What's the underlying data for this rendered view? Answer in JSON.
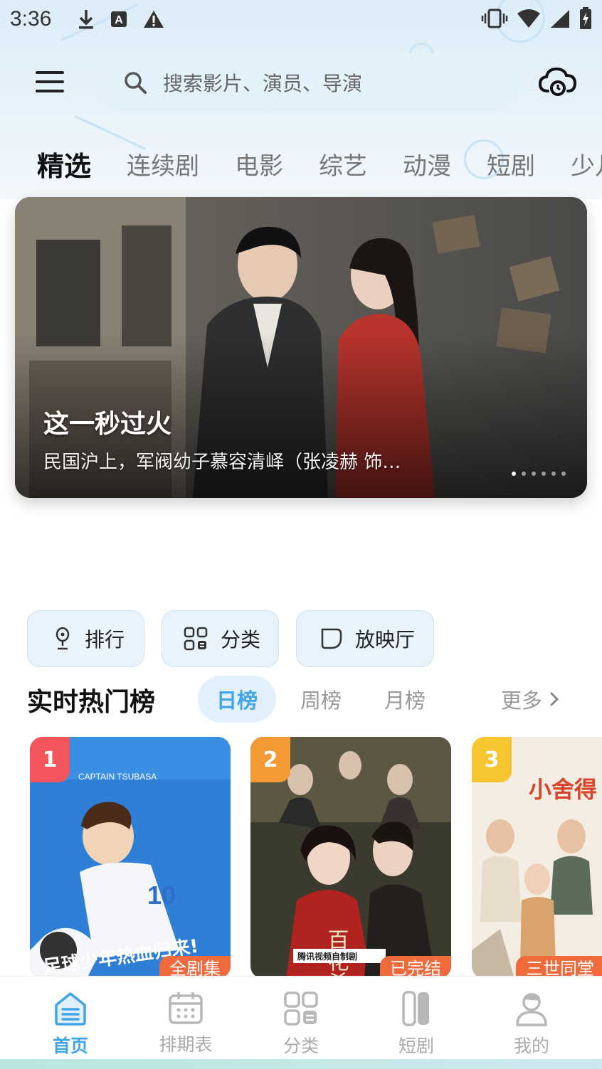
{
  "status_bar": {
    "time": "3:36"
  },
  "header": {
    "search_placeholder": "搜索影片、演员、导演"
  },
  "tabs": [
    {
      "label": "精选",
      "active": true
    },
    {
      "label": "连续剧"
    },
    {
      "label": "电影"
    },
    {
      "label": "综艺"
    },
    {
      "label": "动漫"
    },
    {
      "label": "短剧"
    },
    {
      "label": "少儿"
    }
  ],
  "banner": {
    "title": "这一秒过火",
    "description": "民国沪上，军阀幼子慕容清峄（张凌赫 饰…",
    "slide_count": 6,
    "current_slide": 1
  },
  "quick_entries": [
    {
      "label": "排行",
      "icon": "trophy-icon"
    },
    {
      "label": "分类",
      "icon": "category-grid-icon"
    },
    {
      "label": "放映厅",
      "icon": "screening-hall-icon"
    }
  ],
  "ranking": {
    "title": "实时热门榜",
    "tabs": [
      {
        "label": "日榜",
        "active": true
      },
      {
        "label": "周榜"
      },
      {
        "label": "月榜"
      }
    ],
    "more_label": "更多",
    "items": [
      {
        "rank": "1",
        "badge_color": "#f2555a",
        "tag": "全剧集",
        "poster_text": "足球少年热血归来!",
        "poster_caption": "CAPTAIN TSUBASA"
      },
      {
        "rank": "2",
        "badge_color": "#f39a35",
        "tag": "已完结",
        "poster_text": "百花杀",
        "poster_caption": "腾讯视频自制剧"
      },
      {
        "rank": "3",
        "badge_color": "#f7c530",
        "tag": "三世同堂",
        "poster_text": "小舍得"
      }
    ]
  },
  "bottom_nav": [
    {
      "label": "首页",
      "icon": "home-icon",
      "active": true
    },
    {
      "label": "排期表",
      "icon": "calendar-icon"
    },
    {
      "label": "分类",
      "icon": "category-icon"
    },
    {
      "label": "短剧",
      "icon": "short-drama-icon"
    },
    {
      "label": "我的",
      "icon": "profile-icon"
    }
  ],
  "colors": {
    "accent": "#3fa4e8",
    "header_bg": "#dcedf8",
    "search_bg": "#e3f1fb"
  }
}
